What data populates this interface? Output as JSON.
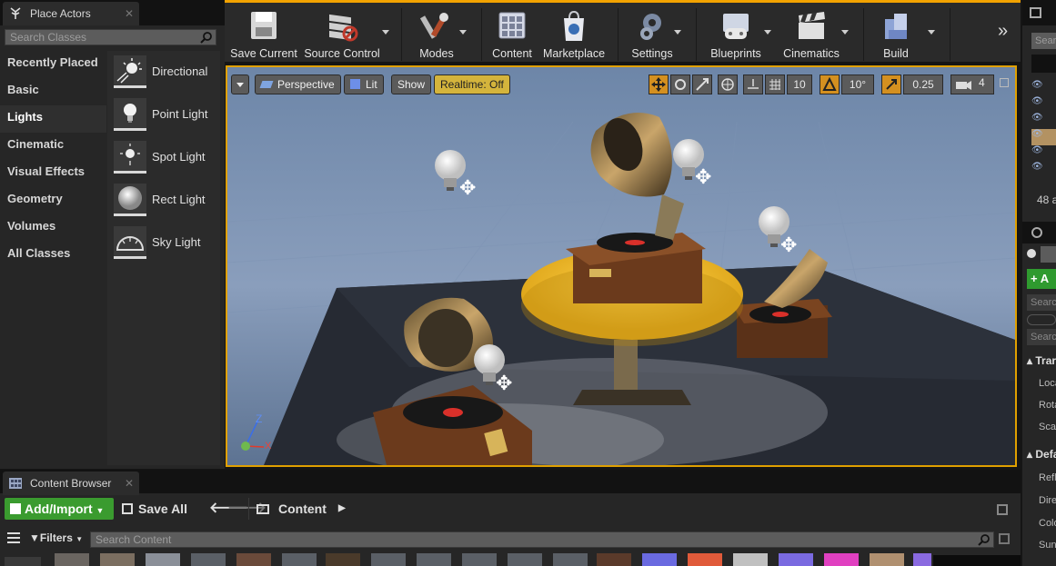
{
  "place_actors": {
    "tab_title": "Place Actors",
    "search_placeholder": "Search Classes",
    "categories": [
      "Recently Placed",
      "Basic",
      "Lights",
      "Cinematic",
      "Visual Effects",
      "Geometry",
      "Volumes",
      "All Classes"
    ],
    "active_category": "Lights",
    "items": [
      {
        "label": "Directional",
        "icon": "directional-light-icon"
      },
      {
        "label": "Point Light",
        "icon": "point-light-icon"
      },
      {
        "label": "Spot Light",
        "icon": "spot-light-icon"
      },
      {
        "label": "Rect Light",
        "icon": "rect-light-icon"
      },
      {
        "label": "Sky Light",
        "icon": "sky-light-icon"
      }
    ]
  },
  "toolbar": {
    "buttons": [
      {
        "label": "Save Current",
        "icon": "save-icon"
      },
      {
        "label": "Source Control",
        "icon": "source-control-icon"
      },
      {
        "label": "Modes",
        "icon": "modes-icon"
      },
      {
        "label": "Content",
        "icon": "content-icon"
      },
      {
        "label": "Marketplace",
        "icon": "marketplace-icon"
      },
      {
        "label": "Settings",
        "icon": "settings-icon"
      },
      {
        "label": "Blueprints",
        "icon": "blueprints-icon"
      },
      {
        "label": "Cinematics",
        "icon": "cinematics-icon"
      },
      {
        "label": "Build",
        "icon": "build-icon"
      }
    ],
    "accent_color": "#f2a200"
  },
  "viewport": {
    "perspective_label": "Perspective",
    "lit_label": "Lit",
    "show_label": "Show",
    "realtime_label": "Realtime: Off",
    "grid_snap": "10",
    "rotation_snap": "10°",
    "scale_snap": "0.25",
    "camera_speed": "4",
    "axis_z": "Z",
    "axis_x": "X"
  },
  "right_panel": {
    "count_text": "48 a",
    "add_label": "+ A",
    "search_stub": "Searc",
    "transform_header": "Trar",
    "location_label": "Loca",
    "rotation_label": "Rota",
    "scale_label": "Scal",
    "default_header": "Defa",
    "refl_label": "Refl",
    "dire_label": "Dire",
    "color_label": "Colo",
    "sun_label": "Sun"
  },
  "content_browser": {
    "tab_title": "Content Browser",
    "add_import_label": "Add/Import",
    "save_all_label": "Save All",
    "path_label": "Content",
    "filters_label": "Filters",
    "search_placeholder": "Search Content"
  }
}
